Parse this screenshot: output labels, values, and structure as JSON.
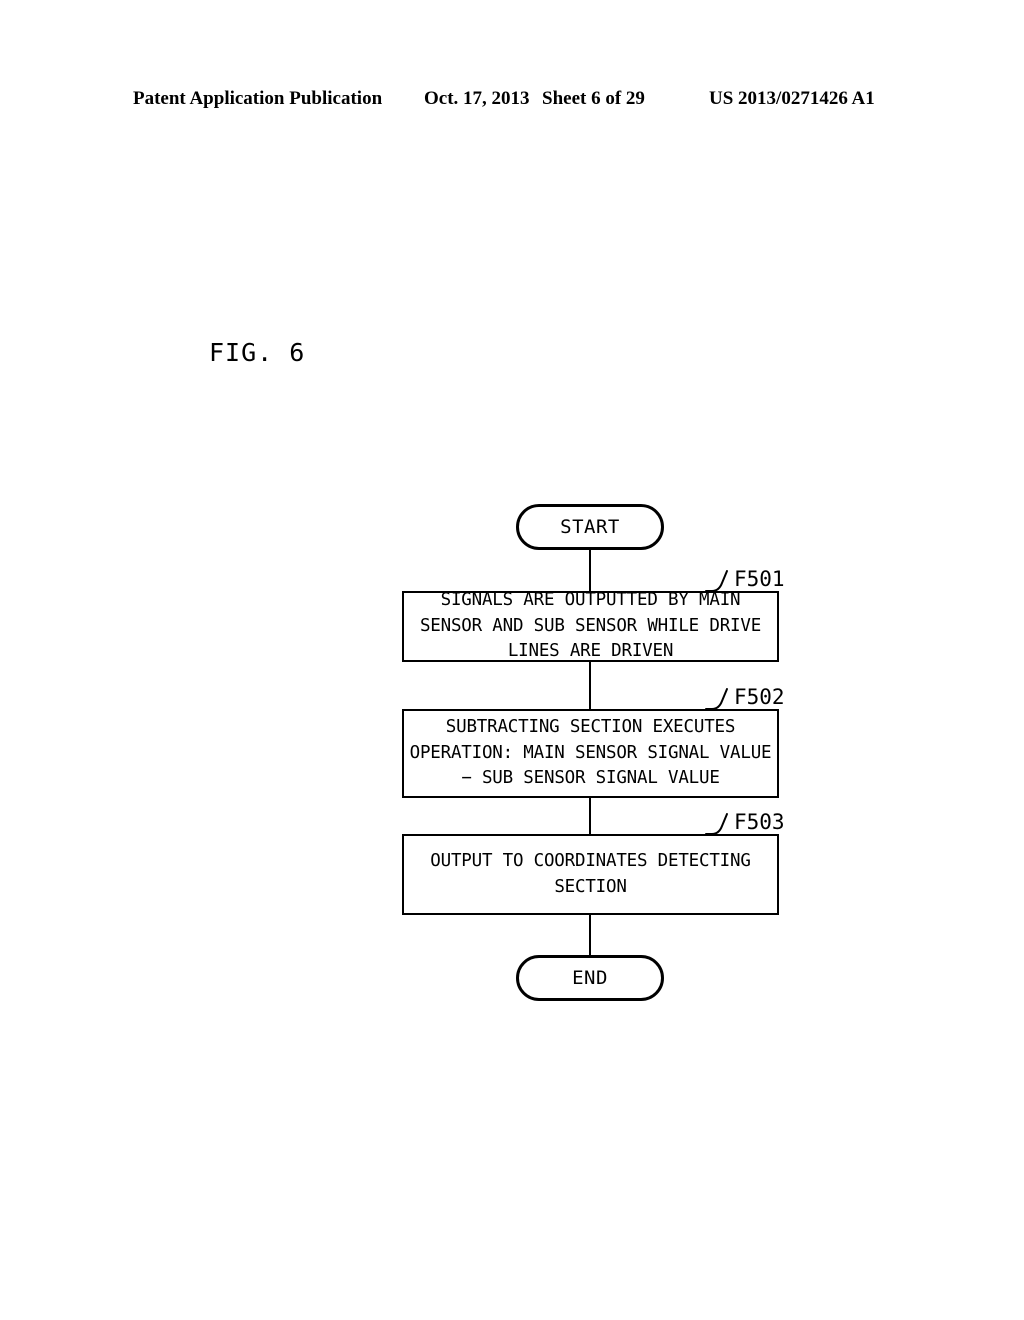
{
  "header": {
    "publication": "Patent Application Publication",
    "date": "Oct. 17, 2013",
    "sheet": "Sheet 6 of 29",
    "patent_number": "US 2013/0271426 A1"
  },
  "figure": {
    "label": "FIG. 6"
  },
  "flowchart": {
    "nodes": [
      {
        "id": "start",
        "type": "terminator",
        "text": "START"
      },
      {
        "id": "f501",
        "type": "process",
        "ref": "F501",
        "text": "SIGNALS ARE OUTPUTTED BY MAIN SENSOR AND SUB SENSOR WHILE DRIVE LINES ARE DRIVEN"
      },
      {
        "id": "f502",
        "type": "process",
        "ref": "F502",
        "text": "SUBTRACTING SECTION EXECUTES OPERATION: MAIN SENSOR SIGNAL VALUE − SUB SENSOR SIGNAL VALUE"
      },
      {
        "id": "f503",
        "type": "process",
        "ref": "F503",
        "text": "OUTPUT TO COORDINATES DETECTING SECTION"
      },
      {
        "id": "end",
        "type": "terminator",
        "text": "END"
      }
    ],
    "colors": {
      "line": "#000000",
      "background": "#ffffff",
      "text": "#000000"
    }
  }
}
